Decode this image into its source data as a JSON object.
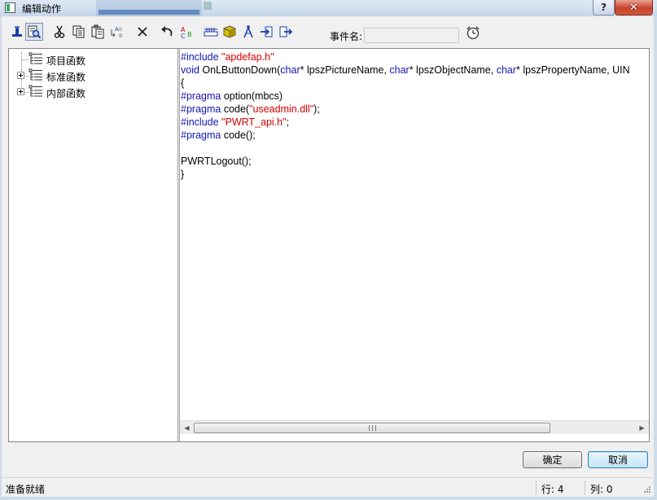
{
  "window": {
    "title": "编辑动作",
    "help_glyph": "?",
    "close_glyph": "✕"
  },
  "toolbar": {
    "event_name_label": "事件名:",
    "event_name_value": "",
    "tools": [
      "function-icon",
      "find-icon",
      "cut-icon",
      "copy-icon",
      "paste-icon",
      "replace-icon",
      "delete-icon",
      "undo-icon",
      "spellcheck-icon",
      "ruler-icon",
      "cube-icon",
      "compass-icon",
      "insert-icon",
      "export-icon",
      "alarm-clock-icon"
    ]
  },
  "tree": {
    "nodes": [
      {
        "label": "项目函数",
        "expandable": false
      },
      {
        "label": "标准函数",
        "expandable": true
      },
      {
        "label": "内部函数",
        "expandable": true
      }
    ]
  },
  "editor": {
    "lines": [
      [
        {
          "t": "#include ",
          "c": "kw"
        },
        {
          "t": "\"apdefap.h\"",
          "c": "str"
        }
      ],
      [
        {
          "t": "void",
          "c": "kw"
        },
        {
          "t": " OnLButtonDown(",
          "c": ""
        },
        {
          "t": "char",
          "c": "kw"
        },
        {
          "t": "* lpszPictureName, ",
          "c": ""
        },
        {
          "t": "char",
          "c": "kw"
        },
        {
          "t": "* lpszObjectName, ",
          "c": ""
        },
        {
          "t": "char",
          "c": "kw"
        },
        {
          "t": "* lpszPropertyName, UIN",
          "c": ""
        }
      ],
      [
        {
          "t": "{",
          "c": ""
        }
      ],
      [
        {
          "t": "#pragma",
          "c": "kw"
        },
        {
          "t": " option(mbcs)",
          "c": ""
        }
      ],
      [
        {
          "t": "#pragma",
          "c": "kw"
        },
        {
          "t": " code(",
          "c": ""
        },
        {
          "t": "\"useadmin.dll\"",
          "c": "str"
        },
        {
          "t": ");",
          "c": ""
        }
      ],
      [
        {
          "t": "#include ",
          "c": "kw"
        },
        {
          "t": "\"PWRT_api.h\"",
          "c": "str"
        },
        {
          "t": ";",
          "c": ""
        }
      ],
      [
        {
          "t": "#pragma",
          "c": "kw"
        },
        {
          "t": " code();",
          "c": ""
        }
      ],
      [
        {
          "t": "",
          "c": ""
        }
      ],
      [
        {
          "t": "PWRTLogout();",
          "c": ""
        }
      ],
      [
        {
          "t": "}",
          "c": ""
        }
      ]
    ]
  },
  "buttons": {
    "ok_label": "确定",
    "cancel_label": "取消"
  },
  "status": {
    "text": "准备就绪",
    "row": "行: 4",
    "col": "列: 0"
  },
  "colors": {
    "keyword": "#1414b4",
    "string": "#d40000"
  }
}
